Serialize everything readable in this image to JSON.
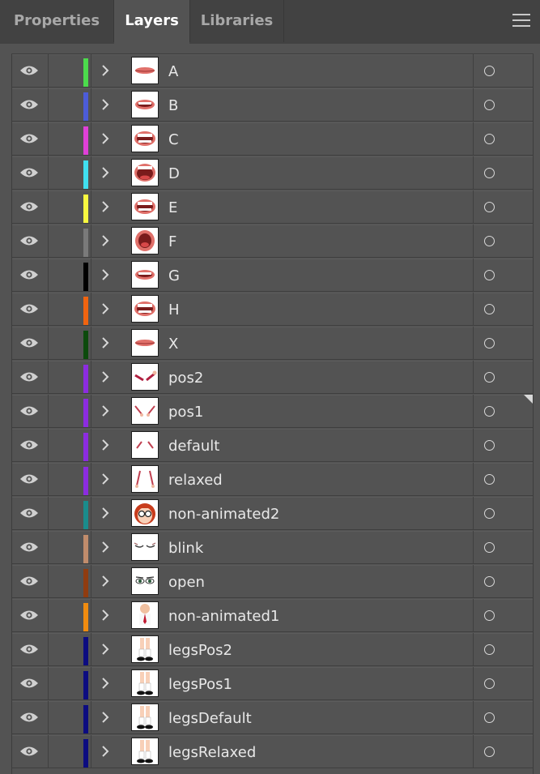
{
  "tabs": [
    {
      "label": "Properties",
      "active": false
    },
    {
      "label": "Layers",
      "active": true
    },
    {
      "label": "Libraries",
      "active": false
    }
  ],
  "layers": [
    {
      "name": "A",
      "color": "#4cdc4c",
      "thumb": "mouth-closed"
    },
    {
      "name": "B",
      "color": "#4c5cd8",
      "thumb": "mouth-teeth"
    },
    {
      "name": "C",
      "color": "#e040d8",
      "thumb": "mouth-open"
    },
    {
      "name": "D",
      "color": "#40e0f0",
      "thumb": "mouth-wide"
    },
    {
      "name": "E",
      "color": "#f8f840",
      "thumb": "mouth-open"
    },
    {
      "name": "F",
      "color": "#7a7a7a",
      "thumb": "mouth-round"
    },
    {
      "name": "G",
      "color": "#000000",
      "thumb": "mouth-teeth"
    },
    {
      "name": "H",
      "color": "#f06410",
      "thumb": "mouth-open"
    },
    {
      "name": "X",
      "color": "#0c4a0c",
      "thumb": "mouth-closed"
    },
    {
      "name": "pos2",
      "color": "#8c2ce0",
      "thumb": "arms-pos2"
    },
    {
      "name": "pos1",
      "color": "#8c2ce0",
      "thumb": "arms-pos1",
      "corner": true
    },
    {
      "name": "default",
      "color": "#8c2ce0",
      "thumb": "arms-default"
    },
    {
      "name": "relaxed",
      "color": "#8c2ce0",
      "thumb": "arms-relaxed"
    },
    {
      "name": "non-animated2",
      "color": "#1a8c8c",
      "thumb": "head"
    },
    {
      "name": "blink",
      "color": "#c08c6c",
      "thumb": "eyes-closed"
    },
    {
      "name": "open",
      "color": "#903c10",
      "thumb": "eyes-open"
    },
    {
      "name": "non-animated1",
      "color": "#f08c10",
      "thumb": "body"
    },
    {
      "name": "legsPos2",
      "color": "#0c0c80",
      "thumb": "legs"
    },
    {
      "name": "legsPos1",
      "color": "#0c0c80",
      "thumb": "legs"
    },
    {
      "name": "legsDefault",
      "color": "#0c0c80",
      "thumb": "legs"
    },
    {
      "name": "legsRelaxed",
      "color": "#0c0c80",
      "thumb": "legs"
    }
  ]
}
